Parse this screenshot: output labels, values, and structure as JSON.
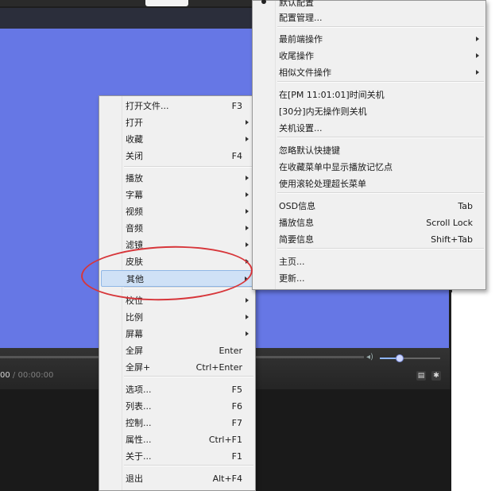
{
  "player": {
    "time_current": "00",
    "time_sep": " / ",
    "time_total": "00:00:00",
    "playlist_icon": "playlist-icon",
    "settings_icon": "gear-icon"
  },
  "main_menu": {
    "items": [
      {
        "label": "打开文件...",
        "shortcut": "F3",
        "submenu": false
      },
      {
        "label": "打开",
        "shortcut": "",
        "submenu": true
      },
      {
        "label": "收藏",
        "shortcut": "",
        "submenu": true
      },
      {
        "label": "关闭",
        "shortcut": "F4",
        "submenu": false
      },
      {
        "label": "播放",
        "shortcut": "",
        "submenu": true
      },
      {
        "label": "字幕",
        "shortcut": "",
        "submenu": true
      },
      {
        "label": "视频",
        "shortcut": "",
        "submenu": true
      },
      {
        "label": "音频",
        "shortcut": "",
        "submenu": true
      },
      {
        "label": "滤镜",
        "shortcut": "",
        "submenu": true
      },
      {
        "label": "皮肤",
        "shortcut": "",
        "submenu": true
      },
      {
        "label": "其他",
        "shortcut": "",
        "submenu": true,
        "highlighted": true
      },
      {
        "label": "校位",
        "shortcut": "",
        "submenu": true
      },
      {
        "label": "比例",
        "shortcut": "",
        "submenu": true
      },
      {
        "label": "屏幕",
        "shortcut": "",
        "submenu": true
      },
      {
        "label": "全屏",
        "shortcut": "Enter",
        "submenu": false
      },
      {
        "label": "全屏+",
        "shortcut": "Ctrl+Enter",
        "submenu": false
      },
      {
        "label": "选项...",
        "shortcut": "F5",
        "submenu": false
      },
      {
        "label": "列表...",
        "shortcut": "F6",
        "submenu": false
      },
      {
        "label": "控制...",
        "shortcut": "F7",
        "submenu": false
      },
      {
        "label": "属性...",
        "shortcut": "Ctrl+F1",
        "submenu": false
      },
      {
        "label": "关于...",
        "shortcut": "F1",
        "submenu": false
      },
      {
        "label": "退出",
        "shortcut": "Alt+F4",
        "submenu": false
      }
    ]
  },
  "sub_menu": {
    "items": [
      {
        "label": "默认配置",
        "shortcut": "",
        "submenu": false,
        "checked": true
      },
      {
        "label": "配置管理...",
        "shortcut": "",
        "submenu": false
      },
      {
        "label": "最前端操作",
        "shortcut": "",
        "submenu": true
      },
      {
        "label": "收尾操作",
        "shortcut": "",
        "submenu": true
      },
      {
        "label": "相似文件操作",
        "shortcut": "",
        "submenu": true
      },
      {
        "label": "在[PM 11:01:01]时间关机",
        "shortcut": "",
        "submenu": false
      },
      {
        "label": "[30分]内无操作则关机",
        "shortcut": "",
        "submenu": false
      },
      {
        "label": "关机设置...",
        "shortcut": "",
        "submenu": false
      },
      {
        "label": "忽略默认快捷键",
        "shortcut": "",
        "submenu": false
      },
      {
        "label": "在收藏菜单中显示播放记忆点",
        "shortcut": "",
        "submenu": false
      },
      {
        "label": "使用滚轮处理超长菜单",
        "shortcut": "",
        "submenu": false
      },
      {
        "label": "OSD信息",
        "shortcut": "Tab",
        "submenu": false
      },
      {
        "label": "播放信息",
        "shortcut": "Scroll Lock",
        "submenu": false
      },
      {
        "label": "简要信息",
        "shortcut": "Shift+Tab",
        "submenu": false
      },
      {
        "label": "主页...",
        "shortcut": "",
        "submenu": false
      },
      {
        "label": "更新...",
        "shortcut": "",
        "submenu": false
      }
    ]
  },
  "annotation": {
    "color": "#d7363a",
    "shape": "ellipse",
    "target": "其他"
  },
  "colors": {
    "video_bg": "#6677e5",
    "menu_bg": "#f0f0f0",
    "highlight": "#cfe1f6"
  }
}
